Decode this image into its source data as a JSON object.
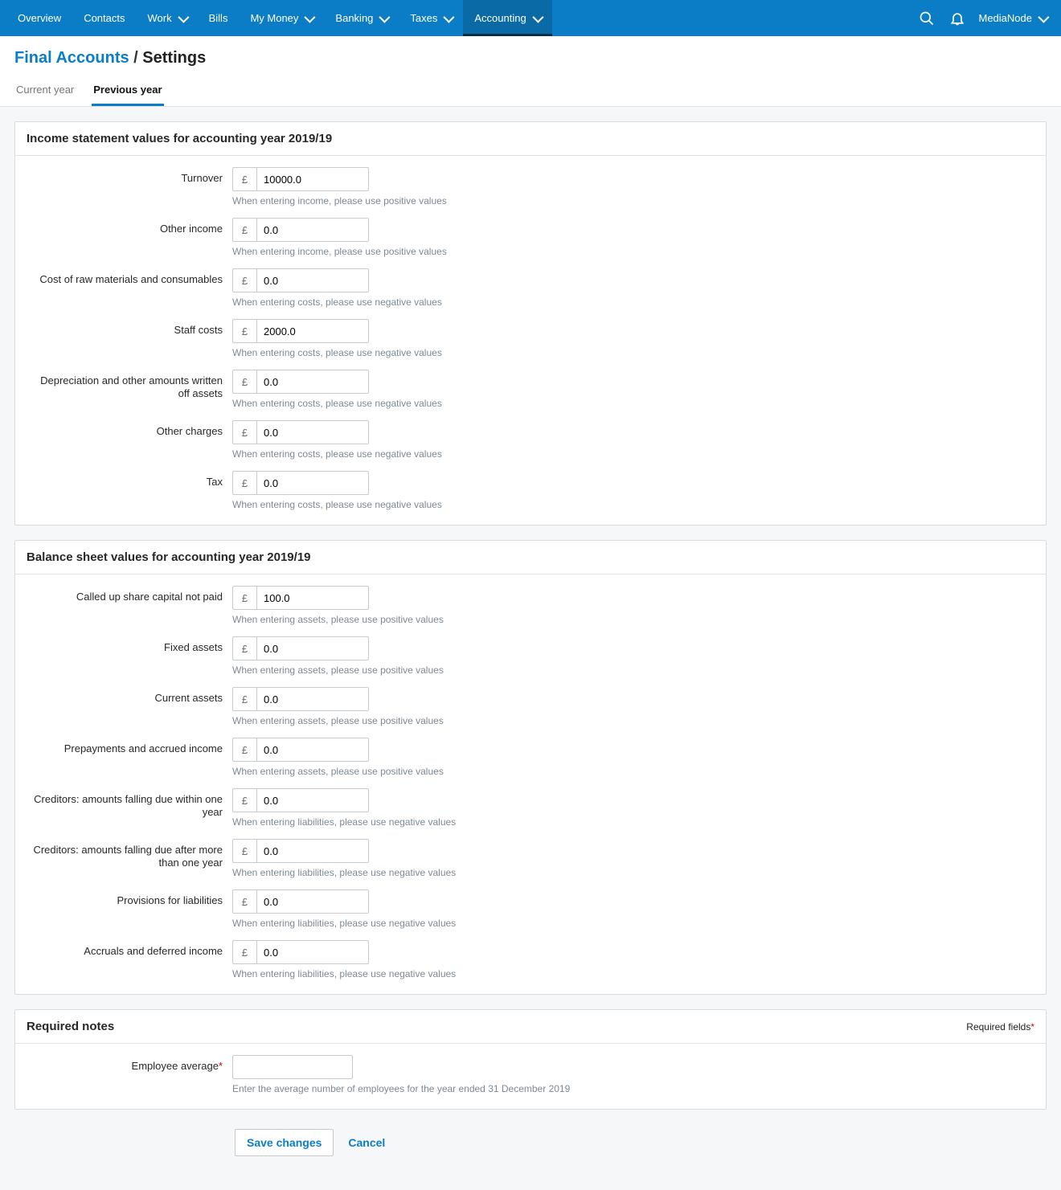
{
  "nav": {
    "items": [
      {
        "label": "Overview",
        "dropdown": false
      },
      {
        "label": "Contacts",
        "dropdown": false
      },
      {
        "label": "Work",
        "dropdown": true
      },
      {
        "label": "Bills",
        "dropdown": false
      },
      {
        "label": "My Money",
        "dropdown": true
      },
      {
        "label": "Banking",
        "dropdown": true
      },
      {
        "label": "Taxes",
        "dropdown": true
      },
      {
        "label": "Accounting",
        "dropdown": true
      }
    ],
    "active": "Accounting",
    "company": "MediaNode"
  },
  "breadcrumb": {
    "link": "Final Accounts",
    "sep": "/",
    "current": "Settings"
  },
  "tabs": {
    "current": "Current year",
    "previous": "Previous year"
  },
  "currency_symbol": "£",
  "sections": {
    "income": {
      "title": "Income statement values for accounting year 2019/19",
      "fields": [
        {
          "label": "Turnover",
          "value": "10000.0",
          "hint": "When entering income, please use positive values"
        },
        {
          "label": "Other income",
          "value": "0.0",
          "hint": "When entering income, please use positive values"
        },
        {
          "label": "Cost of raw materials and consumables",
          "value": "0.0",
          "hint": "When entering costs, please use negative values"
        },
        {
          "label": "Staff costs",
          "value": "2000.0",
          "hint": "When entering costs, please use negative values"
        },
        {
          "label": "Depreciation and other amounts written off assets",
          "value": "0.0",
          "hint": "When entering costs, please use negative values"
        },
        {
          "label": "Other charges",
          "value": "0.0",
          "hint": "When entering costs, please use negative values"
        },
        {
          "label": "Tax",
          "value": "0.0",
          "hint": "When entering costs, please use negative values"
        }
      ]
    },
    "balance": {
      "title": "Balance sheet values for accounting year 2019/19",
      "fields": [
        {
          "label": "Called up share capital not paid",
          "value": "100.0",
          "hint": "When entering assets, please use positive values"
        },
        {
          "label": "Fixed assets",
          "value": "0.0",
          "hint": "When entering assets, please use positive values"
        },
        {
          "label": "Current assets",
          "value": "0.0",
          "hint": "When entering assets, please use positive values"
        },
        {
          "label": "Prepayments and accrued income",
          "value": "0.0",
          "hint": "When entering assets, please use positive values"
        },
        {
          "label": "Creditors: amounts falling due within one year",
          "value": "0.0",
          "hint": "When entering liabilities, please use negative values"
        },
        {
          "label": "Creditors: amounts falling due after more than one year",
          "value": "0.0",
          "hint": "When entering liabilities, please use negative values"
        },
        {
          "label": "Provisions for liabilities",
          "value": "0.0",
          "hint": "When entering liabilities, please use negative values"
        },
        {
          "label": "Accruals and deferred income",
          "value": "0.0",
          "hint": "When entering liabilities, please use negative values"
        }
      ]
    },
    "notes": {
      "title": "Required notes",
      "required_label": "Required fields",
      "fields": [
        {
          "label": "Employee average",
          "required": true,
          "value": "",
          "hint": "Enter the average number of employees for the year ended 31 December 2019"
        }
      ]
    }
  },
  "buttons": {
    "save": "Save changes",
    "cancel": "Cancel"
  }
}
